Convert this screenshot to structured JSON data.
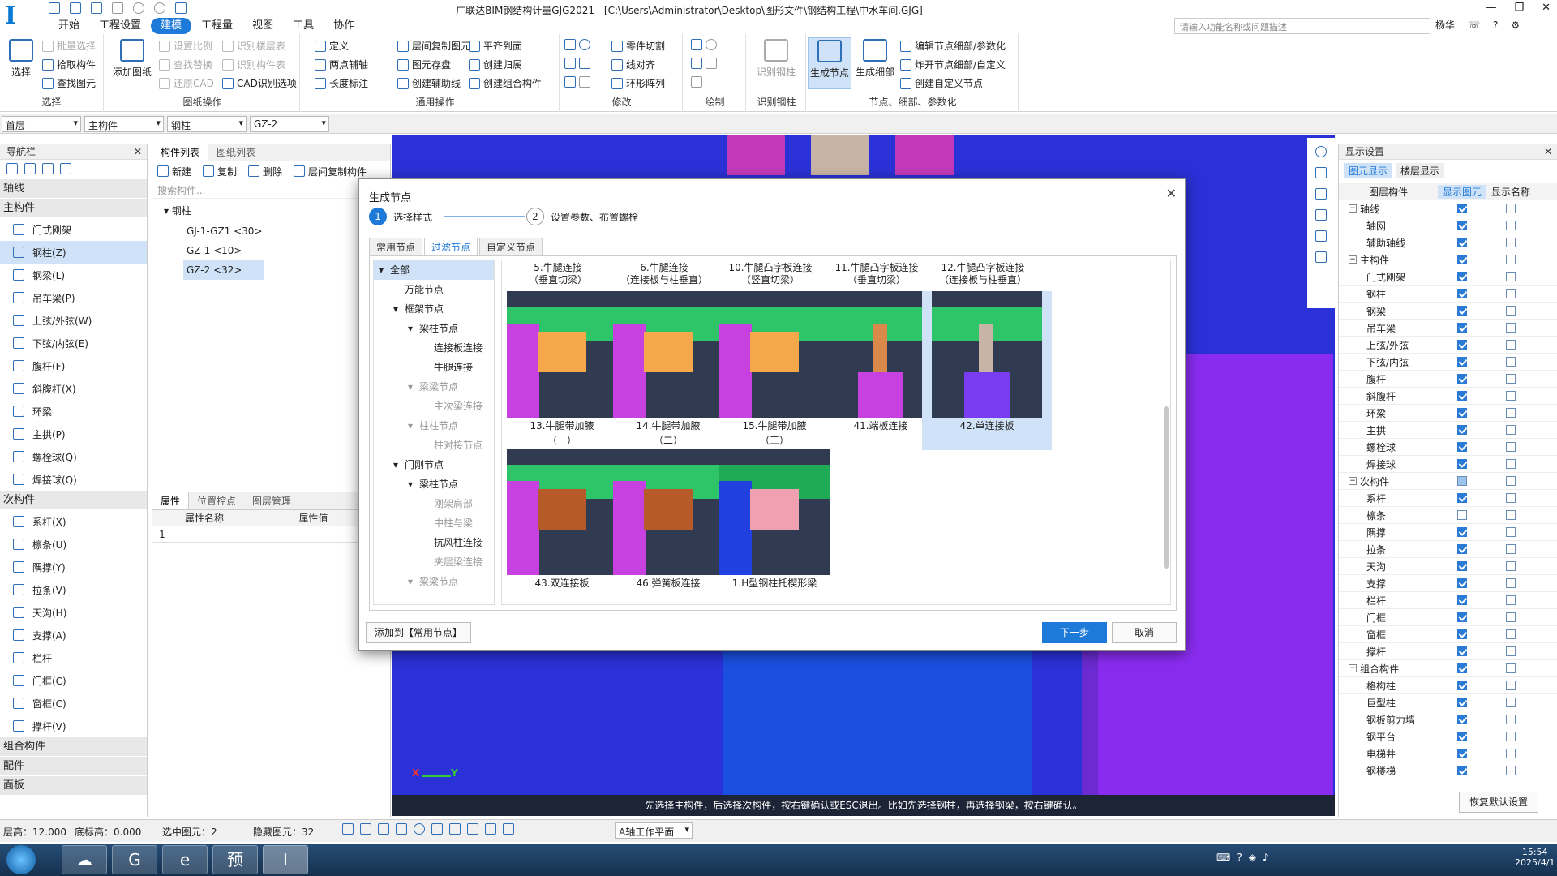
{
  "window": {
    "title": "广联达BIM钢结构计量GJG2021 - [C:\\Users\\Administrator\\Desktop\\图形文件\\钢结构工程\\中水车间.GJG]",
    "search_placeholder": "请输入功能名称或问题描述",
    "user": "杨华"
  },
  "menu": [
    "开始",
    "工程设置",
    "建模",
    "工程量",
    "视图",
    "工具",
    "协作"
  ],
  "ribbon": {
    "select": {
      "big": "选择",
      "items": [
        "批量选择",
        "拾取构件",
        "查找图元"
      ],
      "label": "选择"
    },
    "drawing_ops": {
      "big": "添加图纸",
      "items": [
        "设置比例",
        "查找替换",
        "还原CAD",
        "识别楼层表",
        "识别构件表",
        "CAD识别选项"
      ],
      "label": "图纸操作"
    },
    "common": {
      "items": [
        "定义",
        "两点辅轴",
        "长度标注",
        "层间复制图元",
        "图元存盘",
        "创建辅助线",
        "平齐到面",
        "创建归属",
        "创建组合构件"
      ],
      "label": "通用操作"
    },
    "modify": {
      "items": [
        "零件切割",
        "线对齐",
        "环形阵列"
      ],
      "label": "修改"
    },
    "draw": {
      "label": "绘制"
    },
    "recognize": {
      "big": "识别钢柱",
      "label": "识别钢柱"
    },
    "nodes": {
      "big1": "生成节点",
      "big2": "生成细部",
      "items": [
        "编辑节点细部/参数化",
        "炸开节点细部/自定义",
        "创建自定义节点"
      ],
      "label": "节点、细部、参数化"
    }
  },
  "combos": [
    "首层",
    "主构件",
    "钢柱",
    "GZ-2"
  ],
  "nav": {
    "title": "导航栏",
    "cats": [
      "轴线",
      "主构件",
      "次构件",
      "组合构件",
      "配件",
      "面板"
    ],
    "main_items": [
      "门式刚架",
      "钢柱(Z)",
      "钢梁(L)",
      "吊车梁(P)",
      "上弦/外弦(W)",
      "下弦/内弦(E)",
      "腹杆(F)",
      "斜腹杆(X)",
      "环梁",
      "主拱(P)",
      "螺栓球(Q)",
      "焊接球(Q)"
    ],
    "sub_items": [
      "系杆(X)",
      "檩条(U)",
      "隅撑(Y)",
      "拉条(V)",
      "天沟(H)",
      "支撑(A)",
      "栏杆",
      "门框(C)",
      "窗框(C)",
      "撑杆(V)"
    ]
  },
  "complist": {
    "tabs": [
      "构件列表",
      "图纸列表"
    ],
    "toolbar": [
      "新建",
      "复制",
      "删除",
      "层间复制构件"
    ],
    "search_placeholder": "搜索构件...",
    "root": "钢柱",
    "items": [
      "GJ-1-GZ1 <30>",
      "GZ-1 <10>",
      "GZ-2 <32>"
    ]
  },
  "props": {
    "tabs": [
      "属性",
      "位置控点",
      "图层管理"
    ],
    "col_name": "属性名称",
    "col_value": "属性值",
    "row1": "1"
  },
  "right": {
    "title": "显示设置",
    "tabs": [
      "图元显示",
      "楼层显示"
    ],
    "headers": [
      "图层构件",
      "显示图元",
      "显示名称"
    ],
    "rows": [
      {
        "name": "轴线",
        "group": true,
        "show": true,
        "label": false
      },
      {
        "name": "轴网",
        "show": true,
        "label": false
      },
      {
        "name": "辅助轴线",
        "show": true,
        "label": false
      },
      {
        "name": "主构件",
        "group": true,
        "show": true,
        "label": false
      },
      {
        "name": "门式刚架",
        "show": true,
        "label": false
      },
      {
        "name": "钢柱",
        "show": true,
        "label": false
      },
      {
        "name": "钢梁",
        "show": true,
        "label": false
      },
      {
        "name": "吊车梁",
        "show": true,
        "label": false
      },
      {
        "name": "上弦/外弦",
        "show": true,
        "label": false
      },
      {
        "name": "下弦/内弦",
        "show": true,
        "label": false
      },
      {
        "name": "腹杆",
        "show": true,
        "label": false
      },
      {
        "name": "斜腹杆",
        "show": true,
        "label": false
      },
      {
        "name": "环梁",
        "show": true,
        "label": false
      },
      {
        "name": "主拱",
        "show": true,
        "label": false
      },
      {
        "name": "螺栓球",
        "show": true,
        "label": false
      },
      {
        "name": "焊接球",
        "show": true,
        "label": false
      },
      {
        "name": "次构件",
        "group": true,
        "show": "part",
        "label": false
      },
      {
        "name": "系杆",
        "show": true,
        "label": false
      },
      {
        "name": "檩条",
        "show": false,
        "label": false
      },
      {
        "name": "隅撑",
        "show": true,
        "label": false
      },
      {
        "name": "拉条",
        "show": true,
        "label": false
      },
      {
        "name": "天沟",
        "show": true,
        "label": false
      },
      {
        "name": "支撑",
        "show": true,
        "label": false
      },
      {
        "name": "栏杆",
        "show": true,
        "label": false
      },
      {
        "name": "门框",
        "show": true,
        "label": false
      },
      {
        "name": "窗框",
        "show": true,
        "label": false
      },
      {
        "name": "撑杆",
        "show": true,
        "label": false
      },
      {
        "name": "组合构件",
        "group": true,
        "show": true,
        "label": false
      },
      {
        "name": "格构柱",
        "show": true,
        "label": false
      },
      {
        "name": "巨型柱",
        "show": true,
        "label": false
      },
      {
        "name": "钢板剪力墙",
        "show": true,
        "label": false
      },
      {
        "name": "钢平台",
        "show": true,
        "label": false
      },
      {
        "name": "电梯井",
        "show": true,
        "label": false
      },
      {
        "name": "钢楼梯",
        "show": true,
        "label": false
      }
    ],
    "reset": "恢复默认设置"
  },
  "viewport": {
    "hint": "先选择主构件，后选择次构件，按右键确认或ESC退出。比如先选择钢柱，再选择钢梁，按右键确认。",
    "axis_x": "X",
    "axis_y": "Y"
  },
  "status": {
    "floor_height": "层高：12.000",
    "bottom_elev": "底标高：0.000",
    "selected": "选中图元：2",
    "hidden": "隐藏图元：32",
    "workplane": "A轴工作平面"
  },
  "taskbar": {
    "time": "15:54",
    "date": "2025/4/1",
    "apps": [
      "预"
    ]
  },
  "dialog": {
    "title": "生成节点",
    "steps": [
      {
        "num": "1",
        "label": "选择样式"
      },
      {
        "num": "2",
        "label": "设置参数、布置螺栓"
      }
    ],
    "tabs": [
      "常用节点",
      "过滤节点",
      "自定义节点"
    ],
    "tree": [
      {
        "label": "全部",
        "level": 0,
        "toggle": "▾",
        "sel": true
      },
      {
        "label": "万能节点",
        "level": 1,
        "toggle": ""
      },
      {
        "label": "框架节点",
        "level": 1,
        "toggle": "▾"
      },
      {
        "label": "梁柱节点",
        "level": 2,
        "toggle": "▾"
      },
      {
        "label": "连接板连接",
        "level": 3,
        "toggle": ""
      },
      {
        "label": "牛腿连接",
        "level": 3,
        "toggle": ""
      },
      {
        "label": "梁梁节点",
        "level": 2,
        "toggle": "▾",
        "dim": true
      },
      {
        "label": "主次梁连接",
        "level": 3,
        "toggle": "",
        "dim": true
      },
      {
        "label": "柱柱节点",
        "level": 2,
        "toggle": "▾",
        "dim": true
      },
      {
        "label": "柱对接节点",
        "level": 3,
        "toggle": "",
        "dim": true
      },
      {
        "label": "门刚节点",
        "level": 1,
        "toggle": "▾"
      },
      {
        "label": "梁柱节点",
        "level": 2,
        "toggle": "▾"
      },
      {
        "label": "刚架肩部",
        "level": 3,
        "toggle": "",
        "dim": true
      },
      {
        "label": "中柱与梁",
        "level": 3,
        "toggle": "",
        "dim": true
      },
      {
        "label": "抗风柱连接",
        "level": 3,
        "toggle": ""
      },
      {
        "label": "夹层梁连接",
        "level": 3,
        "toggle": "",
        "dim": true
      },
      {
        "label": "梁梁节点",
        "level": 2,
        "toggle": "▾",
        "dim": true
      }
    ],
    "top_labels": [
      [
        "5.牛腿连接",
        "（垂直切梁）"
      ],
      [
        "6.牛腿连接",
        "（连接板与柱垂直）"
      ],
      [
        "10.牛腿凸字板连接",
        "（竖直切梁）"
      ],
      [
        "11.牛腿凸字板连接",
        "（垂直切梁）"
      ],
      [
        "12.牛腿凸字板连接",
        "（连接板与柱垂直）"
      ]
    ],
    "row1": [
      [
        "13.牛腿带加腋",
        "（一）"
      ],
      [
        "14.牛腿带加腋",
        "（二）"
      ],
      [
        "15.牛腿带加腋",
        "（三）"
      ],
      [
        "41.端板连接",
        ""
      ],
      [
        "42.单连接板",
        ""
      ]
    ],
    "row2": [
      [
        "43.双连接板",
        ""
      ],
      [
        "46.弹簧板连接",
        ""
      ],
      [
        "1.H型钢柱托楔形梁",
        ""
      ]
    ],
    "add_button": "添加到【常用节点】",
    "next_button": "下一步",
    "cancel_button": "取消"
  }
}
